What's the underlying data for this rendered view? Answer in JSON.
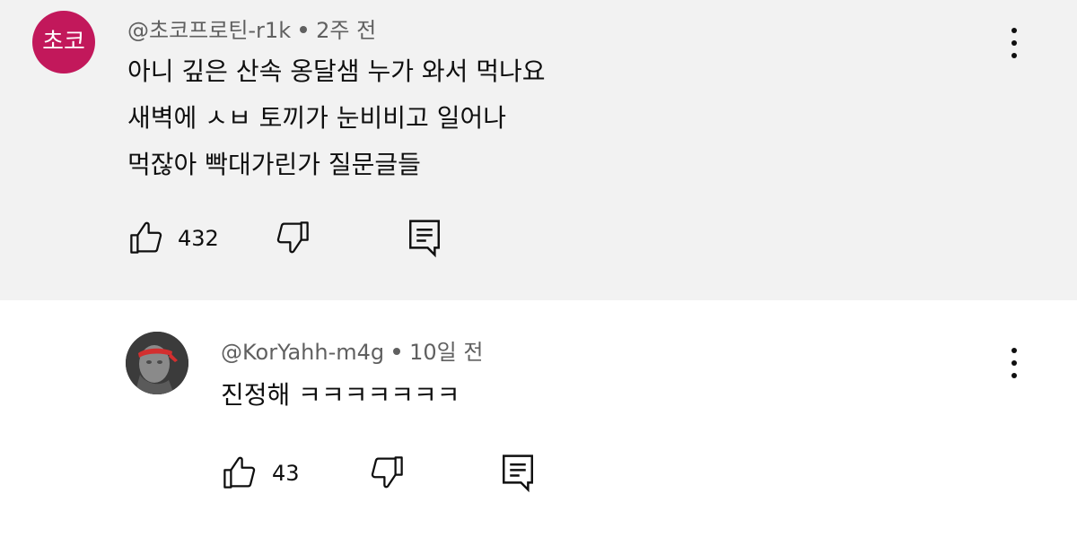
{
  "comments": [
    {
      "avatar_text": "초코",
      "avatar_color": "#c2185b",
      "author": "@초코프로틴-r1k",
      "time": "2주 전",
      "lines": [
        "아니 깊은 산속 옹달샘 누가 와서 먹나요",
        "새벽에 ㅅㅂ 토끼가 눈비비고 일어나",
        "먹잖아 빡대가린가 질문글들"
      ],
      "likes": "432"
    },
    {
      "author": "@KorYahh-m4g",
      "time": "10일 전",
      "lines": [
        "진정해 ㅋㅋㅋㅋㅋㅋㅋ"
      ],
      "likes": "43"
    }
  ],
  "colors": {
    "thread_background": "#f2f2f2",
    "secondary_text": "#606060"
  },
  "icons": [
    "thumb-up-icon",
    "thumb-down-icon",
    "reply-icon",
    "more-vertical-icon"
  ]
}
